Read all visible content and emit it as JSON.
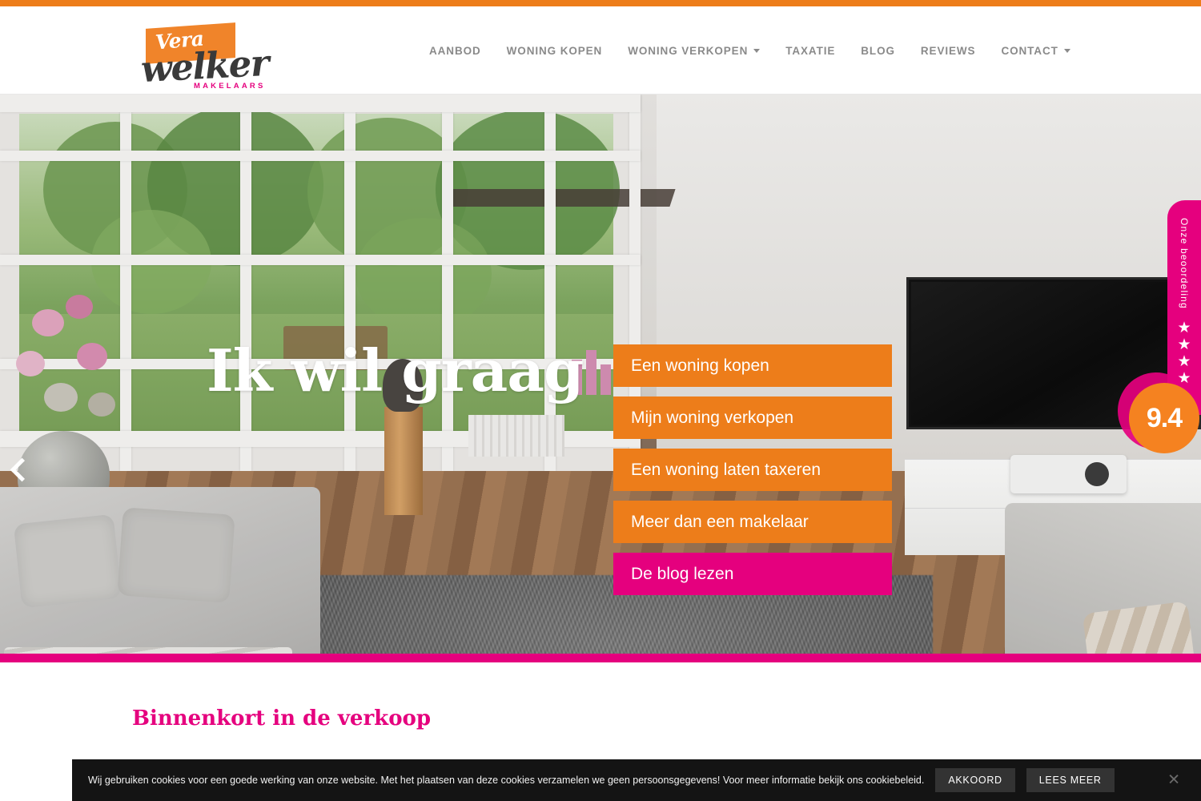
{
  "brand": {
    "logo_top": "Vera",
    "logo_main": "welker",
    "logo_sub": "MAKELAARS",
    "orange": "#ED7D1A",
    "pink": "#E5007E"
  },
  "nav": {
    "items": [
      {
        "label": "AANBOD",
        "has_caret": false
      },
      {
        "label": "WONING KOPEN",
        "has_caret": false
      },
      {
        "label": "WONING VERKOPEN",
        "has_caret": true
      },
      {
        "label": "TAXATIE",
        "has_caret": false
      },
      {
        "label": "BLOG",
        "has_caret": false
      },
      {
        "label": "REVIEWS",
        "has_caret": false
      },
      {
        "label": "CONTACT",
        "has_caret": true
      }
    ]
  },
  "hero": {
    "title": "Ik wil graag",
    "ctas": [
      {
        "label": "Een woning kopen",
        "style": "orange"
      },
      {
        "label": "Mijn woning verkopen",
        "style": "orange"
      },
      {
        "label": "Een woning laten taxeren",
        "style": "orange"
      },
      {
        "label": "Meer dan een makelaar",
        "style": "orange"
      },
      {
        "label": "De blog lezen",
        "style": "pink"
      }
    ],
    "carousel": {
      "slide_count": 5,
      "active_index": 0
    }
  },
  "review_badge": {
    "label": "Onze beoordeling",
    "score": "9.4",
    "stars_full": 4,
    "stars_half": 1,
    "star_glyph": "★",
    "half_star_glyph": "★"
  },
  "content": {
    "section_title": "Binnenkort in de verkoop"
  },
  "cookie": {
    "text": "Wij gebruiken cookies voor een goede werking van onze website. Met het plaatsen van deze cookies verzamelen we geen persoonsgegevens! Voor meer informatie bekijk ons cookiebeleid.",
    "accept_label": "AKKOORD",
    "more_label": "LEES MEER",
    "close_glyph": "✕"
  }
}
